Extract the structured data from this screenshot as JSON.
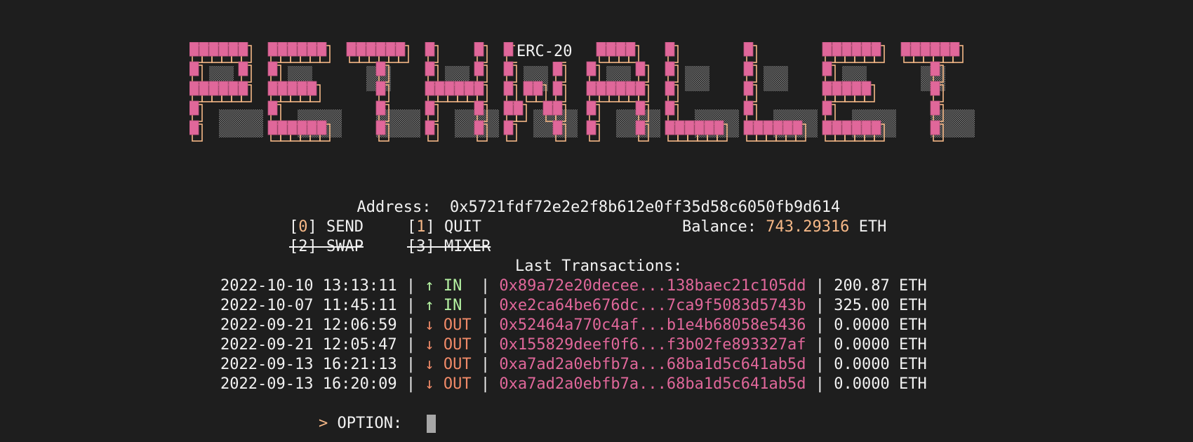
{
  "app": {
    "logo_text": "PETHWALLET",
    "logo_badge": "ERC-20"
  },
  "colors": {
    "background": "#1e1e1e",
    "foreground": "#f2f2f2",
    "logo_fill": "#e0679a",
    "logo_outline": "#f6b887",
    "balance_value": "#f6b887",
    "hash": "#e0679a",
    "in": "#b5f2a2",
    "out": "#f08a68"
  },
  "address": {
    "label": "Address:",
    "value": "0x5721fdf72e2e2f8b612e0ff35d58c6050fb9d614"
  },
  "menu": {
    "send": {
      "key": "0",
      "label": "SEND"
    },
    "quit": {
      "key": "1",
      "label": "QUIT"
    },
    "swap": {
      "key": "2",
      "label": "SWAP",
      "disabled": true
    },
    "mixer": {
      "key": "3",
      "label": "MIXER",
      "disabled": true
    }
  },
  "balance": {
    "label": "Balance:",
    "value": "743.29316",
    "unit": "ETH"
  },
  "transactions": {
    "title": "Last Transactions:",
    "rows": [
      {
        "time": "2022-10-10 13:13:11",
        "arrow": "↑",
        "direction": "IN",
        "hash": "0x89a72e20decee...138baec21c105dd",
        "amount": "200.87",
        "unit": "ETH"
      },
      {
        "time": "2022-10-07 11:45:11",
        "arrow": "↑",
        "direction": "IN",
        "hash": "0xe2ca64be676dc...7ca9f5083d5743b",
        "amount": "325.00",
        "unit": "ETH"
      },
      {
        "time": "2022-09-21 12:06:59",
        "arrow": "↓",
        "direction": "OUT",
        "hash": "0x52464a770c4af...b1e4b68058e5436",
        "amount": "0.0000",
        "unit": "ETH"
      },
      {
        "time": "2022-09-21 12:05:47",
        "arrow": "↓",
        "direction": "OUT",
        "hash": "0x155829deef0f6...f3b02fe893327af",
        "amount": "0.0000",
        "unit": "ETH"
      },
      {
        "time": "2022-09-13 16:21:13",
        "arrow": "↓",
        "direction": "OUT",
        "hash": "0xa7ad2a0ebfb7a...68ba1d5c641ab5d",
        "amount": "0.0000",
        "unit": "ETH"
      },
      {
        "time": "2022-09-13 16:20:09",
        "arrow": "↓",
        "direction": "OUT",
        "hash": "0xa7ad2a0ebfb7a...68ba1d5c641ab5d",
        "amount": "0.0000",
        "unit": "ETH"
      }
    ]
  },
  "prompt": {
    "marker": ">",
    "label": "OPTION:",
    "value": ""
  }
}
